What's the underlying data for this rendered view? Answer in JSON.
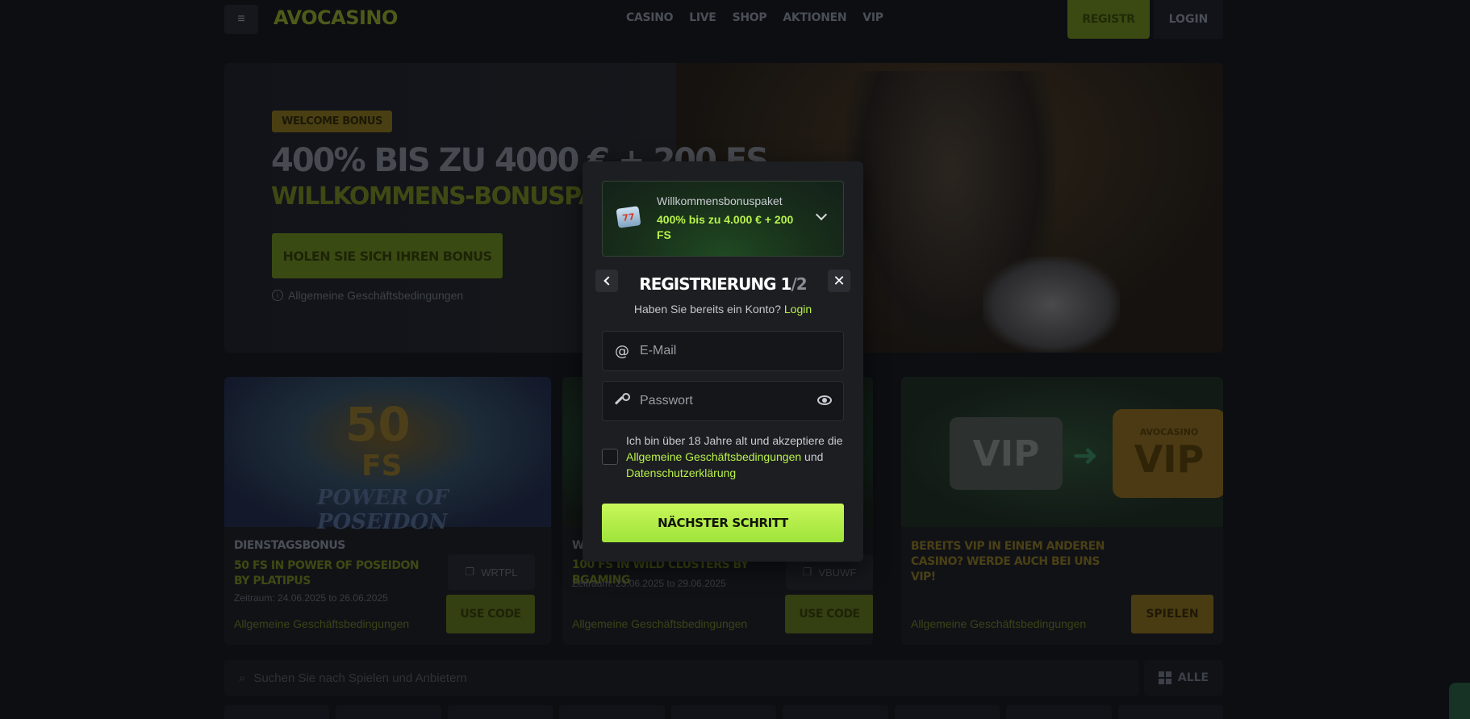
{
  "header": {
    "logo": "AVOCASINO",
    "nav": [
      "CASINO",
      "LIVE",
      "SHOP",
      "AKTIONEN",
      "VIP"
    ],
    "register_label": "REGISTR",
    "login_label": "LOGIN"
  },
  "hero": {
    "badge": "WELCOME BONUS",
    "title": "400% BIS ZU 4000 € + 200 FS",
    "subtitle": "WILLKOMMENS-BONUSPAKET",
    "cta": "HOLEN SIE SICH IHREN BONUS",
    "terms": "Allgemeine Geschäftsbedingungen"
  },
  "cards": [
    {
      "category": "DIENSTAGSBONUS",
      "title": "50 FS IN POWER OF POSEIDON BY PLATIPUS",
      "period": "Zeitraum: 24.06.2025 to 26.06.2025",
      "code": "WRTPL",
      "button": "USE CODE",
      "terms": "Allgemeine Geschäftsbedingungen",
      "image_text": {
        "num": "50",
        "fs": "FS",
        "game": "POWER OF POSEIDON"
      }
    },
    {
      "category": "W",
      "title": "100 FS IN WILD CLUSTERS BY BGAMING",
      "period": "Zeitraum: 23.06.2025 to 29.06.2025",
      "code": "VBUWF",
      "button": "USE CODE",
      "terms": "Allgemeine Geschäftsbedingungen"
    },
    {
      "title": "BEREITS VIP IN EINEM ANDEREN CASINO? WERDE AUCH BEI UNS VIP!",
      "button": "SPIELEN",
      "terms": "Allgemeine Geschäftsbedingungen",
      "image_text": {
        "left": "VIP",
        "right_top": "AVOCASINO",
        "right": "VIP"
      }
    }
  ],
  "search": {
    "placeholder": "Suchen Sie nach Spielen und Anbietern",
    "all_label": "ALLE"
  },
  "modal": {
    "bonus_label": "Willkommensbonuspaket",
    "bonus_value": "400% bis zu 4.000 € + 200 FS",
    "slot_icon_text": "77",
    "title": "REGISTRIERUNG",
    "step_current": "1",
    "step_total": "/2",
    "have_account": "Haben Sie bereits ein Konto?",
    "login_link": "Login",
    "email_placeholder": "E-Mail",
    "password_placeholder": "Passwort",
    "agree_prefix": "Ich bin über 18 Jahre alt und akzeptiere die",
    "agree_terms": "Allgemeine Geschäftsbedingungen",
    "agree_and": "und",
    "agree_privacy": "Datenschutzerklärung",
    "next_button": "NÄCHSTER SCHRITT"
  }
}
